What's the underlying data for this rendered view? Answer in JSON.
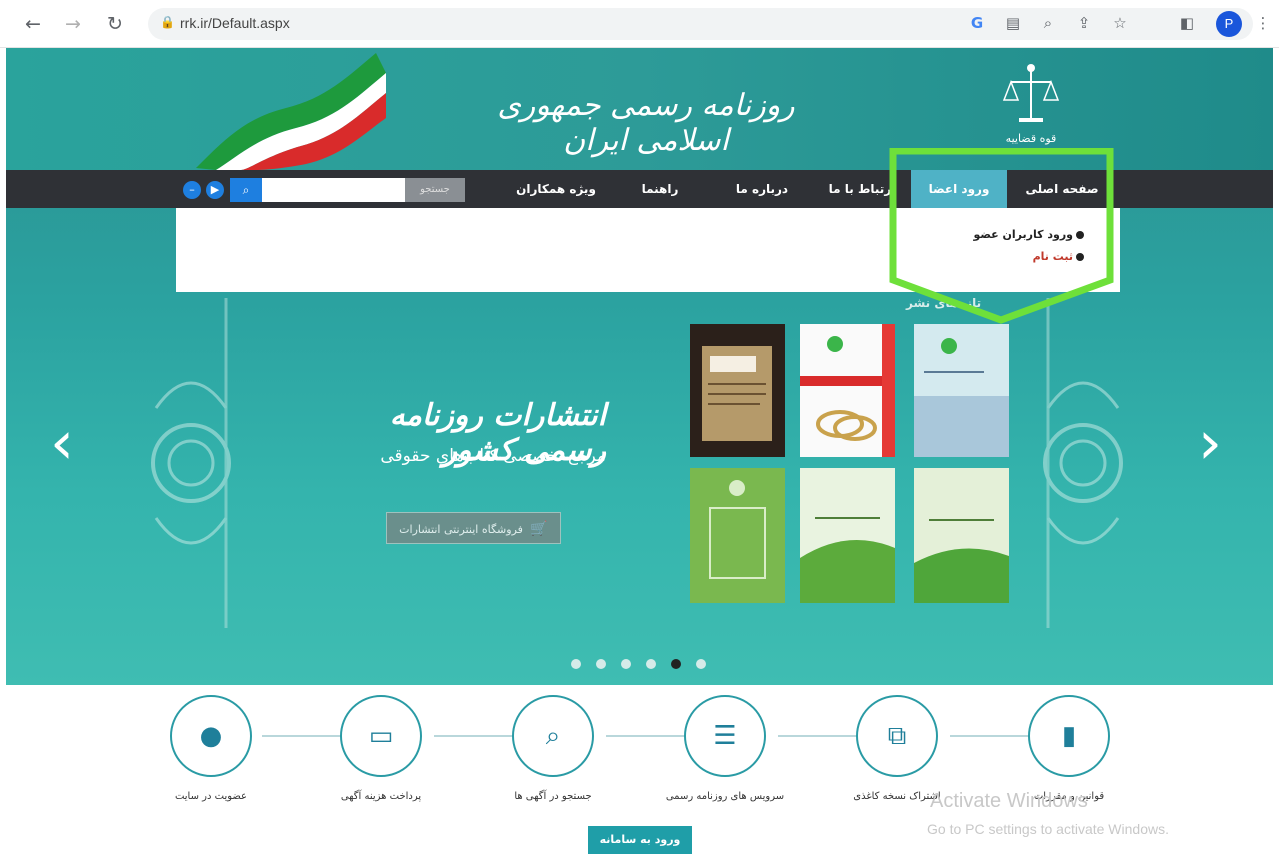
{
  "browser": {
    "url": "rrk.ir/Default.aspx",
    "profile_initial": "P",
    "icons": [
      "back-arrow-icon",
      "forward-arrow-icon",
      "reload-icon",
      "lock-icon",
      "google-icon",
      "translate-icon",
      "zoom-icon",
      "share-icon",
      "star-icon",
      "sidebar-icon",
      "menu-icon"
    ]
  },
  "header": {
    "title": "روزنامه رسمی جمهوری اسلامی ایران",
    "emblem_text": "قوه قضاییه"
  },
  "menu": {
    "items": [
      {
        "label": "صفحه اصلی"
      },
      {
        "label": "ورود اعضا"
      },
      {
        "label": "ارتباط با ما"
      },
      {
        "label": "درباره ما"
      },
      {
        "label": "راهنما"
      },
      {
        "label": "ویژه همکاران"
      }
    ],
    "search_select": "جستجو",
    "search_placeholder": ""
  },
  "dropdown": {
    "items": [
      {
        "label": "ورود کاربران عضو"
      },
      {
        "label": "ثبت نام"
      }
    ]
  },
  "slider": {
    "title": "انتشارات روزنامه رسمی کشور",
    "subtitle": "مرجع تخصصی کتاب‌های حقوقی",
    "shop_button": "فروشگاه اینترنتی انتشارات",
    "books_label": "تازه‌های نشر",
    "active_dot": 5,
    "dot_count": 6
  },
  "steps": [
    {
      "label": "قوانین و مقررات",
      "icon": "document-icon"
    },
    {
      "label": "اشتراک نسخه کاغذی",
      "icon": "copy-icon"
    },
    {
      "label": "سرویس های روزنامه رسمی",
      "icon": "list-icon"
    },
    {
      "label": "جستجو در آگهی ها",
      "icon": "search-icon"
    },
    {
      "label": "پرداخت هزینه آگهی",
      "icon": "credit-card-icon"
    },
    {
      "label": "عضویت در سایت",
      "icon": "user-icon"
    }
  ],
  "enter_button": "ورود به سامانه",
  "watermark": {
    "line1": "Activate Windows",
    "line2": "Go to PC settings to activate Windows."
  },
  "colors": {
    "teal": "#2ba2a0",
    "menu_bg": "#2f3136",
    "active_menu": "#4fb2c6",
    "highlight": "#6ee03a"
  }
}
